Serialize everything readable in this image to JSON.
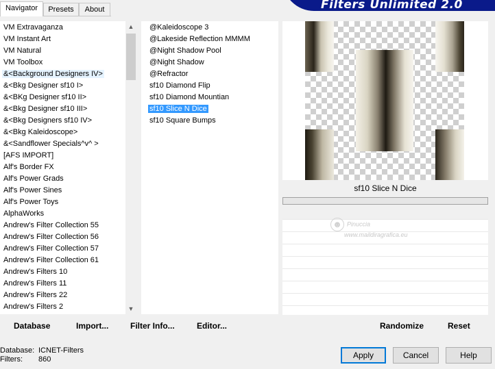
{
  "tabs": [
    "Navigator",
    "Presets",
    "About"
  ],
  "banner_title": "Filters Unlimited 2.0",
  "categories": [
    "VM Extravaganza",
    "VM Instant Art",
    "VM Natural",
    "VM Toolbox",
    "&<Background Designers IV>",
    "&<Bkg Designer sf10 I>",
    "&<BKg Designer sf10 II>",
    "&<Bkg Designer sf10 III>",
    "&<Bkg Designers sf10 IV>",
    "&<Bkg Kaleidoscope>",
    "&<Sandflower Specials^v^ >",
    "[AFS IMPORT]",
    "Alf's Border FX",
    "Alf's Power Grads",
    "Alf's Power Sines",
    "Alf's Power Toys",
    "AlphaWorks",
    "Andrew's Filter Collection 55",
    "Andrew's Filter Collection 56",
    "Andrew's Filter Collection 57",
    "Andrew's Filter Collection 61",
    "Andrew's Filters 10",
    "Andrew's Filters 11",
    "Andrew's Filters 22",
    "Andrew's Filters 2"
  ],
  "filters": [
    "@Kaleidoscope 3",
    "@Lakeside Reflection MMMM",
    "@Night Shadow Pool",
    "@Night Shadow",
    "@Refractor",
    "sf10 Diamond Flip",
    "sf10 Diamond Mountian",
    "sf10 Slice N Dice",
    "sf10 Square Bumps"
  ],
  "selected_filter_name": "sf10 Slice N Dice",
  "watermark": {
    "line1": "Pinuccia",
    "line2": "www.maildiragrafica.eu"
  },
  "toolbar_left": {
    "database": "Database",
    "import": "Import...",
    "filter_info": "Filter Info...",
    "editor": "Editor..."
  },
  "toolbar_right": {
    "randomize": "Randomize",
    "reset": "Reset"
  },
  "status": {
    "database_label": "Database:",
    "database_value": "ICNET-Filters",
    "filters_label": "Filters:",
    "filters_value": "860"
  },
  "buttons": {
    "apply": "Apply",
    "cancel": "Cancel",
    "help": "Help"
  },
  "colors": {
    "selection": "#3399ff",
    "banner": "#0a1a8a",
    "default_button_border": "#0078d7"
  }
}
